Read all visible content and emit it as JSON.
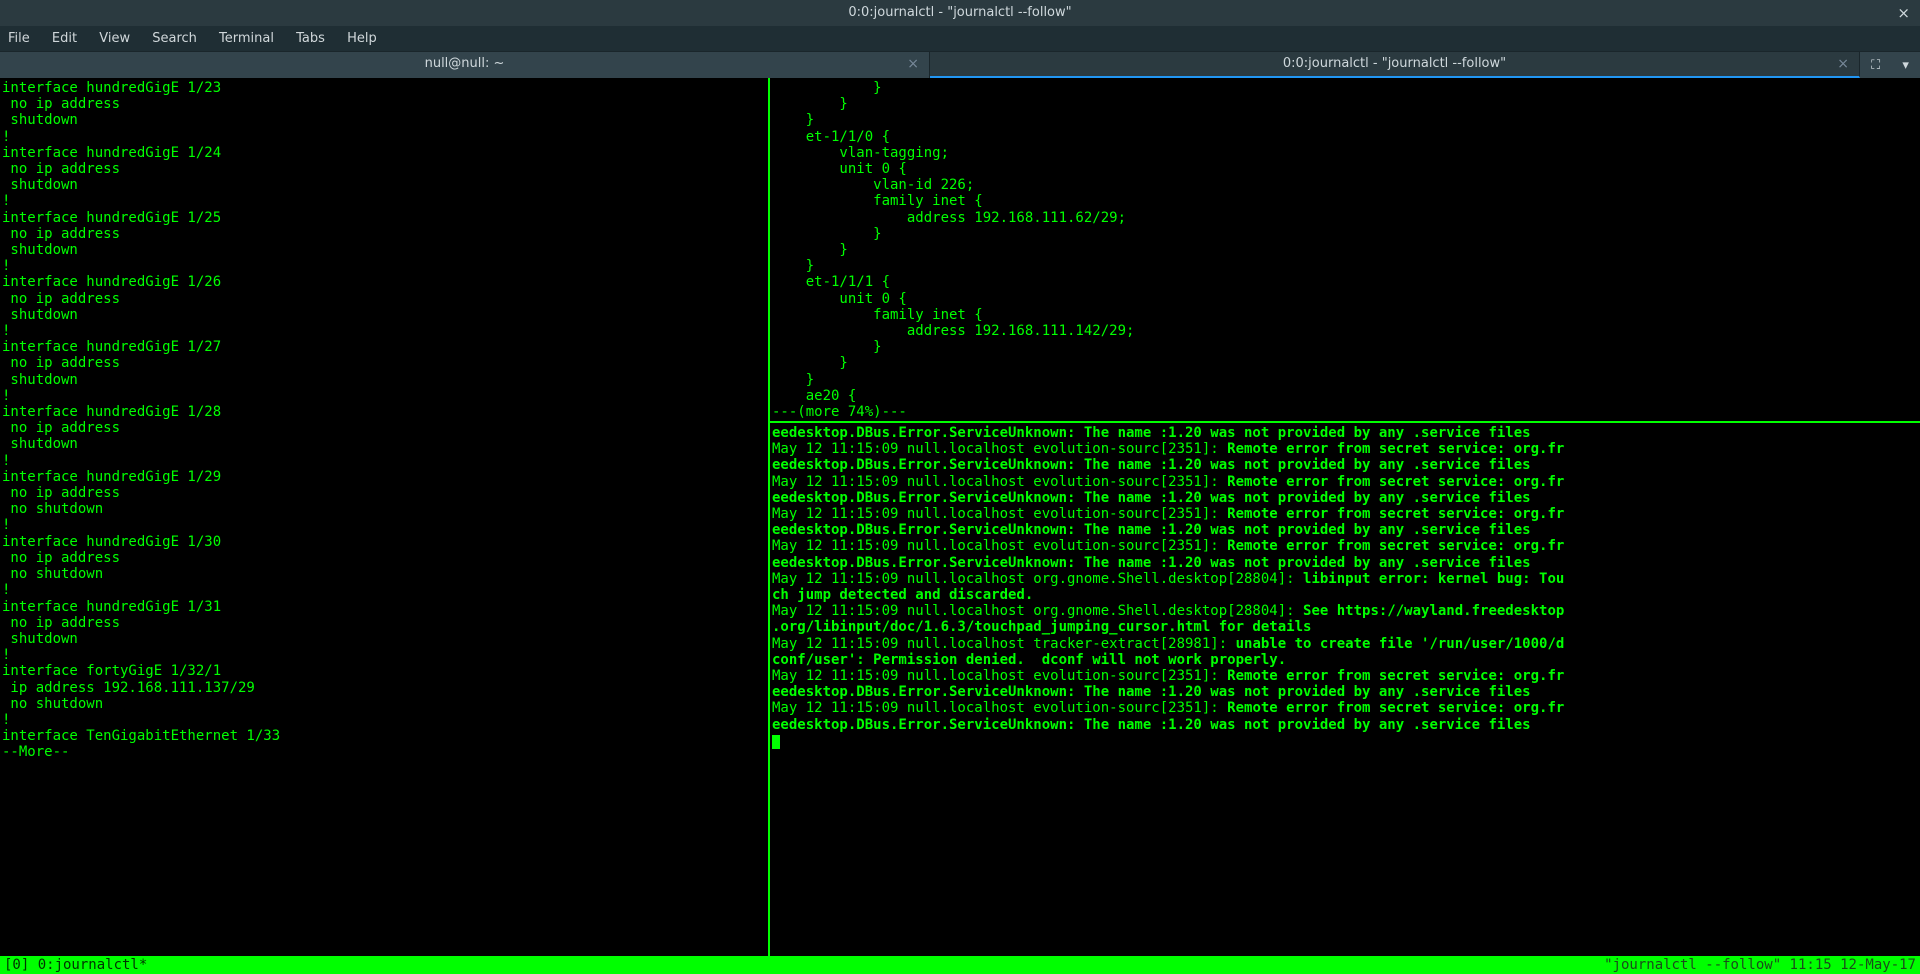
{
  "window": {
    "title": "0:0:journalctl - \"journalctl --follow\"",
    "close_glyph": "×"
  },
  "menu": {
    "file": "File",
    "edit": "Edit",
    "view": "View",
    "search": "Search",
    "terminal": "Terminal",
    "tabs": "Tabs",
    "help": "Help"
  },
  "tabs": {
    "tab0": "null@null: ~",
    "tab1": "0:0:journalctl - \"journalctl --follow\"",
    "close_glyph": "×",
    "screenshot_glyph": "⛶",
    "dropdown_glyph": "▾"
  },
  "left_pane": "interface hundredGigE 1/23\n no ip address\n shutdown\n!\ninterface hundredGigE 1/24\n no ip address\n shutdown\n!\ninterface hundredGigE 1/25\n no ip address\n shutdown\n!\ninterface hundredGigE 1/26\n no ip address\n shutdown\n!\ninterface hundredGigE 1/27\n no ip address\n shutdown\n!\ninterface hundredGigE 1/28\n no ip address\n shutdown\n!\ninterface hundredGigE 1/29\n no ip address\n no shutdown\n!\ninterface hundredGigE 1/30\n no ip address\n no shutdown\n!\ninterface hundredGigE 1/31\n no ip address\n shutdown\n!\ninterface fortyGigE 1/32/1\n ip address 192.168.111.137/29\n no shutdown\n!\ninterface TenGigabitEthernet 1/33\n--More--",
  "right_top": "            }\n        }\n    }\n    et-1/1/0 {\n        vlan-tagging;\n        unit 0 {\n            vlan-id 226;\n            family inet {\n                address 192.168.111.62/29;\n            }\n        }\n    }\n    et-1/1/1 {\n        unit 0 {\n            family inet {\n                address 192.168.111.142/29;\n            }\n        }\n    }\n    ae20 {\n---(more 74%)---",
  "log": {
    "l01b": "eedesktop.DBus.Error.ServiceUnknown: The name :1.20 was not provided by any .service files",
    "l02a": "May 12 11:15:09 null.localhost evolution-sourc[2351]: ",
    "l02b": "Remote error from secret service: org.fr",
    "l03b": "eedesktop.DBus.Error.ServiceUnknown: The name :1.20 was not provided by any .service files",
    "l04a": "May 12 11:15:09 null.localhost evolution-sourc[2351]: ",
    "l04b": "Remote error from secret service: org.fr",
    "l05b": "eedesktop.DBus.Error.ServiceUnknown: The name :1.20 was not provided by any .service files",
    "l06a": "May 12 11:15:09 null.localhost evolution-sourc[2351]: ",
    "l06b": "Remote error from secret service: org.fr",
    "l07b": "eedesktop.DBus.Error.ServiceUnknown: The name :1.20 was not provided by any .service files",
    "l08a": "May 12 11:15:09 null.localhost evolution-sourc[2351]: ",
    "l08b": "Remote error from secret service: org.fr",
    "l09b": "eedesktop.DBus.Error.ServiceUnknown: The name :1.20 was not provided by any .service files",
    "l10a": "May 12 11:15:09 null.localhost org.gnome.Shell.desktop[28804]: ",
    "l10b": "libinput error: kernel bug: Tou",
    "l11b": "ch jump detected and discarded.",
    "l12a": "May 12 11:15:09 null.localhost org.gnome.Shell.desktop[28804]: ",
    "l12b": "See https://wayland.freedesktop",
    "l13b": ".org/libinput/doc/1.6.3/touchpad_jumping_cursor.html for details",
    "l14a": "May 12 11:15:09 null.localhost tracker-extract[28981]: ",
    "l14b": "unable to create file '/run/user/1000/d",
    "l15b": "conf/user': Permission denied.  dconf will not work properly.",
    "l16a": "May 12 11:15:09 null.localhost evolution-sourc[2351]: ",
    "l16b": "Remote error from secret service: org.fr",
    "l17b": "eedesktop.DBus.Error.ServiceUnknown: The name :1.20 was not provided by any .service files",
    "l18a": "May 12 11:15:09 null.localhost evolution-sourc[2351]: ",
    "l18b": "Remote error from secret service: org.fr",
    "l19b": "eedesktop.DBus.Error.ServiceUnknown: The name :1.20 was not provided by any .service files"
  },
  "tmux": {
    "left": "[0] 0:journalctl*",
    "right": "\"journalctl --follow\" 11:15 12-May-17"
  }
}
